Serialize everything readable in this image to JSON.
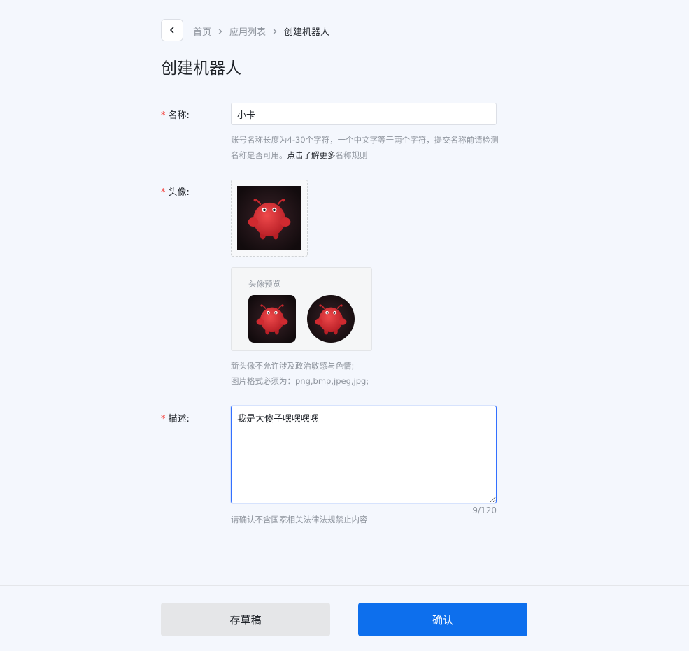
{
  "breadcrumb": {
    "items": [
      "首页",
      "应用列表",
      "创建机器人"
    ]
  },
  "page_title": "创建机器人",
  "form": {
    "required_mark": "*",
    "name": {
      "label": "名称:",
      "value": "小卡",
      "help_text": "账号名称长度为4-30个字符，一个中文字等于两个字符，提交名称前请检测名称是否可用。",
      "help_link": "点击了解更多",
      "help_suffix": "名称规则"
    },
    "avatar": {
      "label": "头像:",
      "preview_title": "头像预览",
      "notes": [
        "新头像不允许涉及政治敏感与色情;",
        "图片格式必须为：png,bmp,jpeg,jpg;"
      ]
    },
    "description": {
      "label": "描述:",
      "value": "我是大傻子嘿嘿嘿嘿",
      "counter": "9/120",
      "help_text": "请确认不含国家相关法律法规禁止内容"
    }
  },
  "footer": {
    "draft_label": "存草稿",
    "confirm_label": "确认"
  },
  "colors": {
    "primary": "#0d6fed",
    "required": "#f54a45",
    "avatar_bg": "#1c1114",
    "avatar_body": "#e03236"
  },
  "icons": {
    "back": "chevron-left-icon",
    "separator": "chevron-right-icon",
    "avatar": "red-robot-avatar"
  }
}
